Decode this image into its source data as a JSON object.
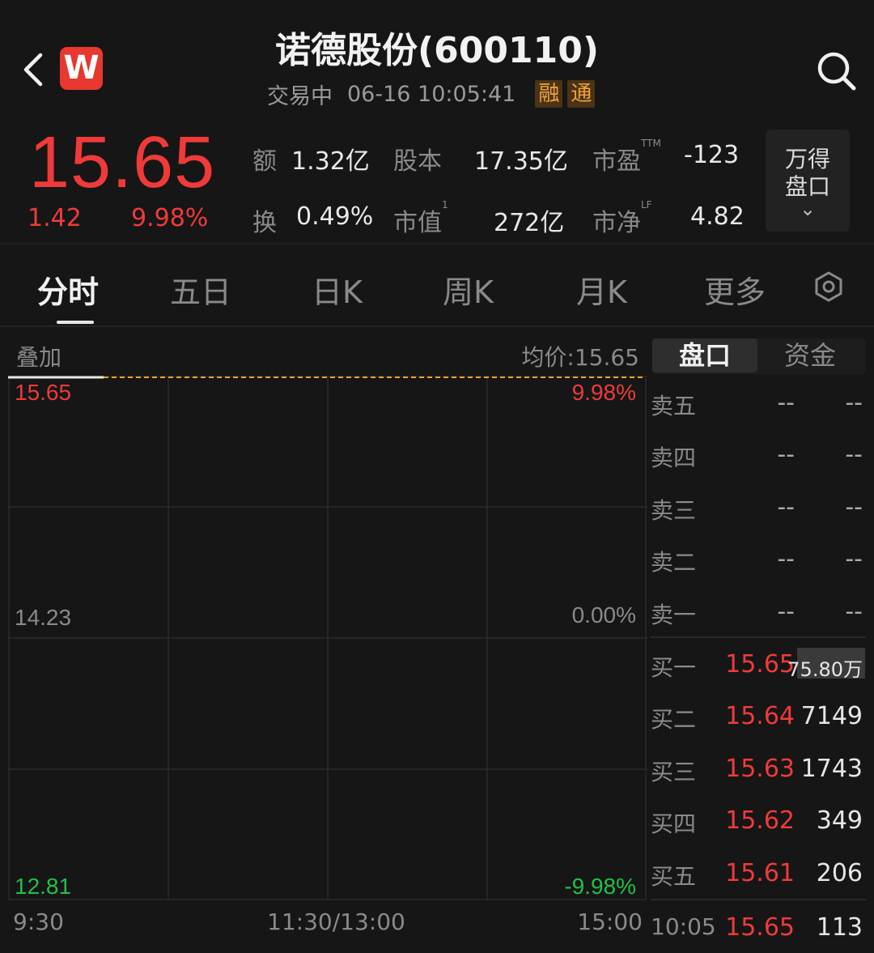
{
  "header": {
    "logo_letter": "W",
    "title": "诺德股份(600110)",
    "status": "交易中",
    "datetime": "06-16 10:05:41",
    "tags": [
      "融",
      "通"
    ]
  },
  "quote": {
    "price": "15.65",
    "change": "1.42",
    "change_pct": "9.98%",
    "stats": [
      {
        "label": "额",
        "sup": "",
        "value": "1.32亿"
      },
      {
        "label": "股本",
        "sup": "",
        "value": "17.35亿"
      },
      {
        "label": "市盈",
        "sup": "TTM",
        "value": "-123"
      },
      {
        "label": "换",
        "sup": "",
        "value": "0.49%"
      },
      {
        "label": "市值",
        "sup": "1",
        "value": "272亿"
      },
      {
        "label": "市净",
        "sup": "LF",
        "value": "4.82"
      }
    ],
    "wande_button": {
      "line1": "万得",
      "line2": "盘口",
      "chevron": "⌄"
    }
  },
  "tabs": [
    "分时",
    "五日",
    "日K",
    "周K",
    "月K",
    "更多"
  ],
  "chart": {
    "overlay_label": "叠加",
    "avg_price": "均价:15.65",
    "y_top": "15.65",
    "y_mid": "14.23",
    "y_bottom": "12.81",
    "pct_top": "9.98%",
    "pct_mid": "0.00%",
    "pct_bottom": "-9.98%",
    "time_start": "9:30",
    "time_mid": "11:30/13:00",
    "time_end": "15:00",
    "colors": {
      "up": "#f03a3a",
      "down": "#21c04a",
      "grid": "#2a2a2a",
      "line": "#f0a030"
    }
  },
  "chart_data": {
    "type": "line",
    "title": "",
    "xlabel": "",
    "ylabel": "",
    "x": [
      "9:30",
      "10:05"
    ],
    "series": [
      {
        "values": [
          15.65,
          15.65
        ]
      }
    ],
    "ylim": [
      12.81,
      15.65
    ],
    "y_ticks": [
      "15.65",
      "14.23",
      "12.81"
    ],
    "pct_ticks": [
      "9.98%",
      "0.00%",
      "-9.98%"
    ],
    "x_ticks": [
      "9:30",
      "11:30/13:00",
      "15:00"
    ],
    "grid": true
  },
  "order_book": {
    "tab_active": "盘口",
    "tab_other": "资金",
    "asks": [
      {
        "label": "卖五",
        "price": "--",
        "volume": "--"
      },
      {
        "label": "卖四",
        "price": "--",
        "volume": "--"
      },
      {
        "label": "卖三",
        "price": "--",
        "volume": "--"
      },
      {
        "label": "卖二",
        "price": "--",
        "volume": "--"
      },
      {
        "label": "卖一",
        "price": "--",
        "volume": "--"
      }
    ],
    "bids": [
      {
        "label": "买一",
        "price": "15.65",
        "volume": "75.80万"
      },
      {
        "label": "买二",
        "price": "15.64",
        "volume": "7149"
      },
      {
        "label": "买三",
        "price": "15.63",
        "volume": "1743"
      },
      {
        "label": "买四",
        "price": "15.62",
        "volume": "349"
      },
      {
        "label": "买五",
        "price": "15.61",
        "volume": "206"
      }
    ],
    "last_trade": {
      "time": "10:05",
      "price": "15.65",
      "volume": "113"
    }
  }
}
